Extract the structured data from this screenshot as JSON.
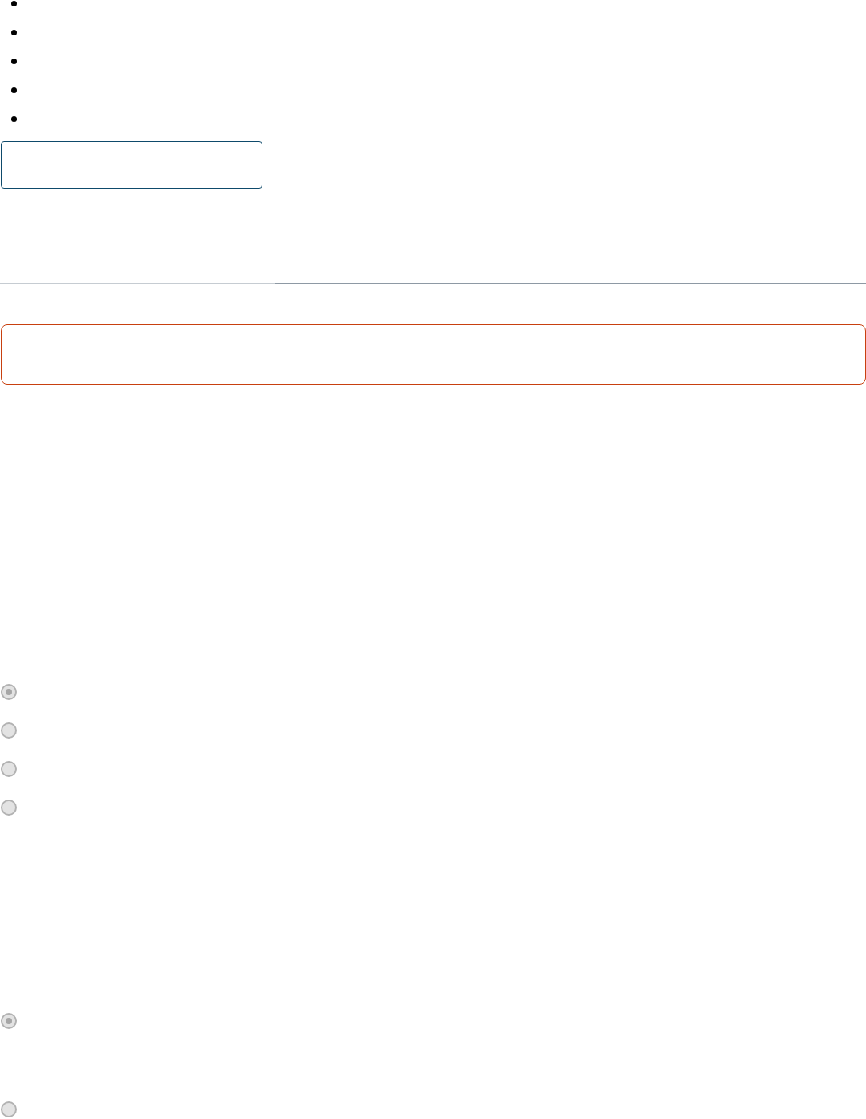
{
  "bullet_list": [
    {
      "kind": "bullet"
    },
    {
      "kind": "bullet"
    },
    {
      "kind": "bullet"
    },
    {
      "kind": "bullet"
    },
    {
      "kind": "bullet"
    }
  ],
  "field": {
    "kind": "text"
  },
  "link": {
    "kind": "underline"
  },
  "alert": {
    "kind": "error"
  },
  "radio_groups": [
    {
      "options": [
        {
          "selected": true,
          "disabled": true
        },
        {
          "selected": false,
          "disabled": true
        },
        {
          "selected": false,
          "disabled": true
        },
        {
          "selected": false,
          "disabled": true
        }
      ]
    },
    {
      "options": [
        {
          "selected": true,
          "disabled": true
        },
        {
          "selected": false,
          "disabled": true
        }
      ]
    }
  ]
}
